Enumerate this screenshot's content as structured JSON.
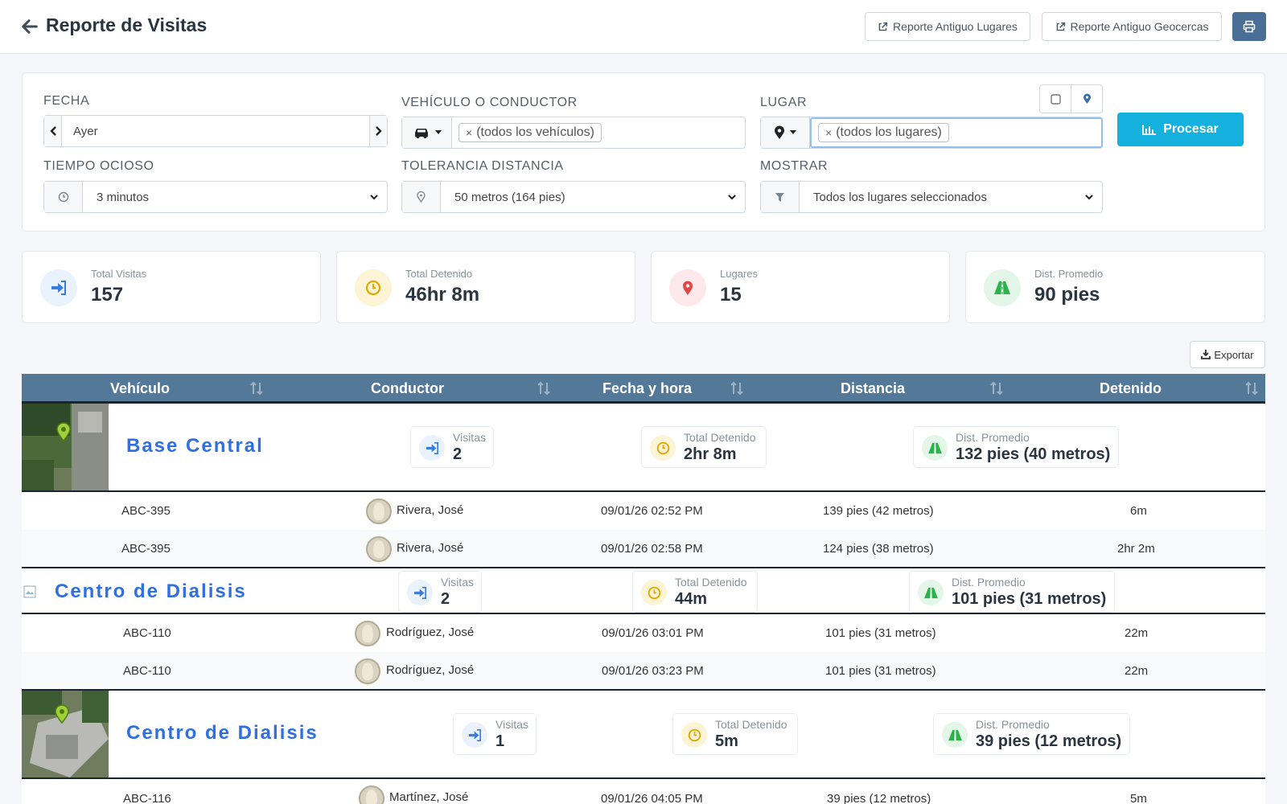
{
  "header": {
    "title": "Reporte de Visitas",
    "btn_lugares": "Reporte Antiguo Lugares",
    "btn_geocercas": "Reporte Antiguo Geocercas"
  },
  "filters": {
    "fecha_label": "FECHA",
    "fecha_value": "Ayer",
    "vehiculo_label": "VEHÍCULO O CONDUCTOR",
    "vehiculo_tag": "(todos los vehículos)",
    "lugar_label": "LUGAR",
    "lugar_tag": "(todos los lugares)",
    "tiempo_label": "TIEMPO OCIOSO",
    "tiempo_value": "3 minutos",
    "tolerancia_label": "TOLERANCIA DISTANCIA",
    "tolerancia_value": "50 metros (164 pies)",
    "mostrar_label": "MOSTRAR",
    "mostrar_value": "Todos los lugares seleccionados",
    "procesar": "Procesar"
  },
  "stats": [
    {
      "label": "Total Visitas",
      "value": "157"
    },
    {
      "label": "Total Detenido",
      "value": "46hr 8m"
    },
    {
      "label": "Lugares",
      "value": "15"
    },
    {
      "label": "Dist. Promedio",
      "value": "90 pies"
    }
  ],
  "export_label": "Exportar",
  "table": {
    "columns": [
      "Vehículo",
      "Conductor",
      "Fecha y hora",
      "Distancia",
      "Detenido"
    ],
    "groups": [
      {
        "name": "Base Central",
        "visitas_label": "Visitas",
        "visitas": "2",
        "detenido_label": "Total Detenido",
        "detenido": "2hr 8m",
        "dist_label": "Dist. Promedio",
        "dist": "132 pies (40 metros)",
        "rows": [
          {
            "vehiculo": "ABC-395",
            "conductor": "Rivera, José",
            "fecha": "09/01/26 02:52 PM",
            "distancia": "139 pies (42 metros)",
            "detenido": "6m"
          },
          {
            "vehiculo": "ABC-395",
            "conductor": "Rivera, José",
            "fecha": "09/01/26 02:58 PM",
            "distancia": "124 pies (38 metros)",
            "detenido": "2hr 2m"
          }
        ]
      },
      {
        "name": "Centro de Dialisis",
        "visitas_label": "Visitas",
        "visitas": "2",
        "detenido_label": "Total Detenido",
        "detenido": "44m",
        "dist_label": "Dist. Promedio",
        "dist": "101 pies (31 metros)",
        "rows": [
          {
            "vehiculo": "ABC-110",
            "conductor": "Rodríguez, José",
            "fecha": "09/01/26 03:01 PM",
            "distancia": "101 pies (31 metros)",
            "detenido": "22m"
          },
          {
            "vehiculo": "ABC-110",
            "conductor": "Rodríguez, José",
            "fecha": "09/01/26 03:23 PM",
            "distancia": "101 pies (31 metros)",
            "detenido": "22m"
          }
        ]
      },
      {
        "name": "Centro de Dialisis",
        "visitas_label": "Visitas",
        "visitas": "1",
        "detenido_label": "Total Detenido",
        "detenido": "5m",
        "dist_label": "Dist. Promedio",
        "dist": "39 pies (12 metros)",
        "rows": [
          {
            "vehiculo": "ABC-116",
            "conductor": "Martínez, José",
            "fecha": "09/01/26 04:05 PM",
            "distancia": "39 pies (12 metros)",
            "detenido": "5m"
          }
        ]
      }
    ]
  },
  "colors": {
    "primary_blue": "#2f6fe0",
    "process_cyan": "#14b0de",
    "table_header": "#547898",
    "print_button": "#4a6f96",
    "icon_blue": "#3b7ddd",
    "icon_yellow": "#e0a800",
    "icon_red": "#e04848",
    "icon_green": "#2bb24c"
  }
}
